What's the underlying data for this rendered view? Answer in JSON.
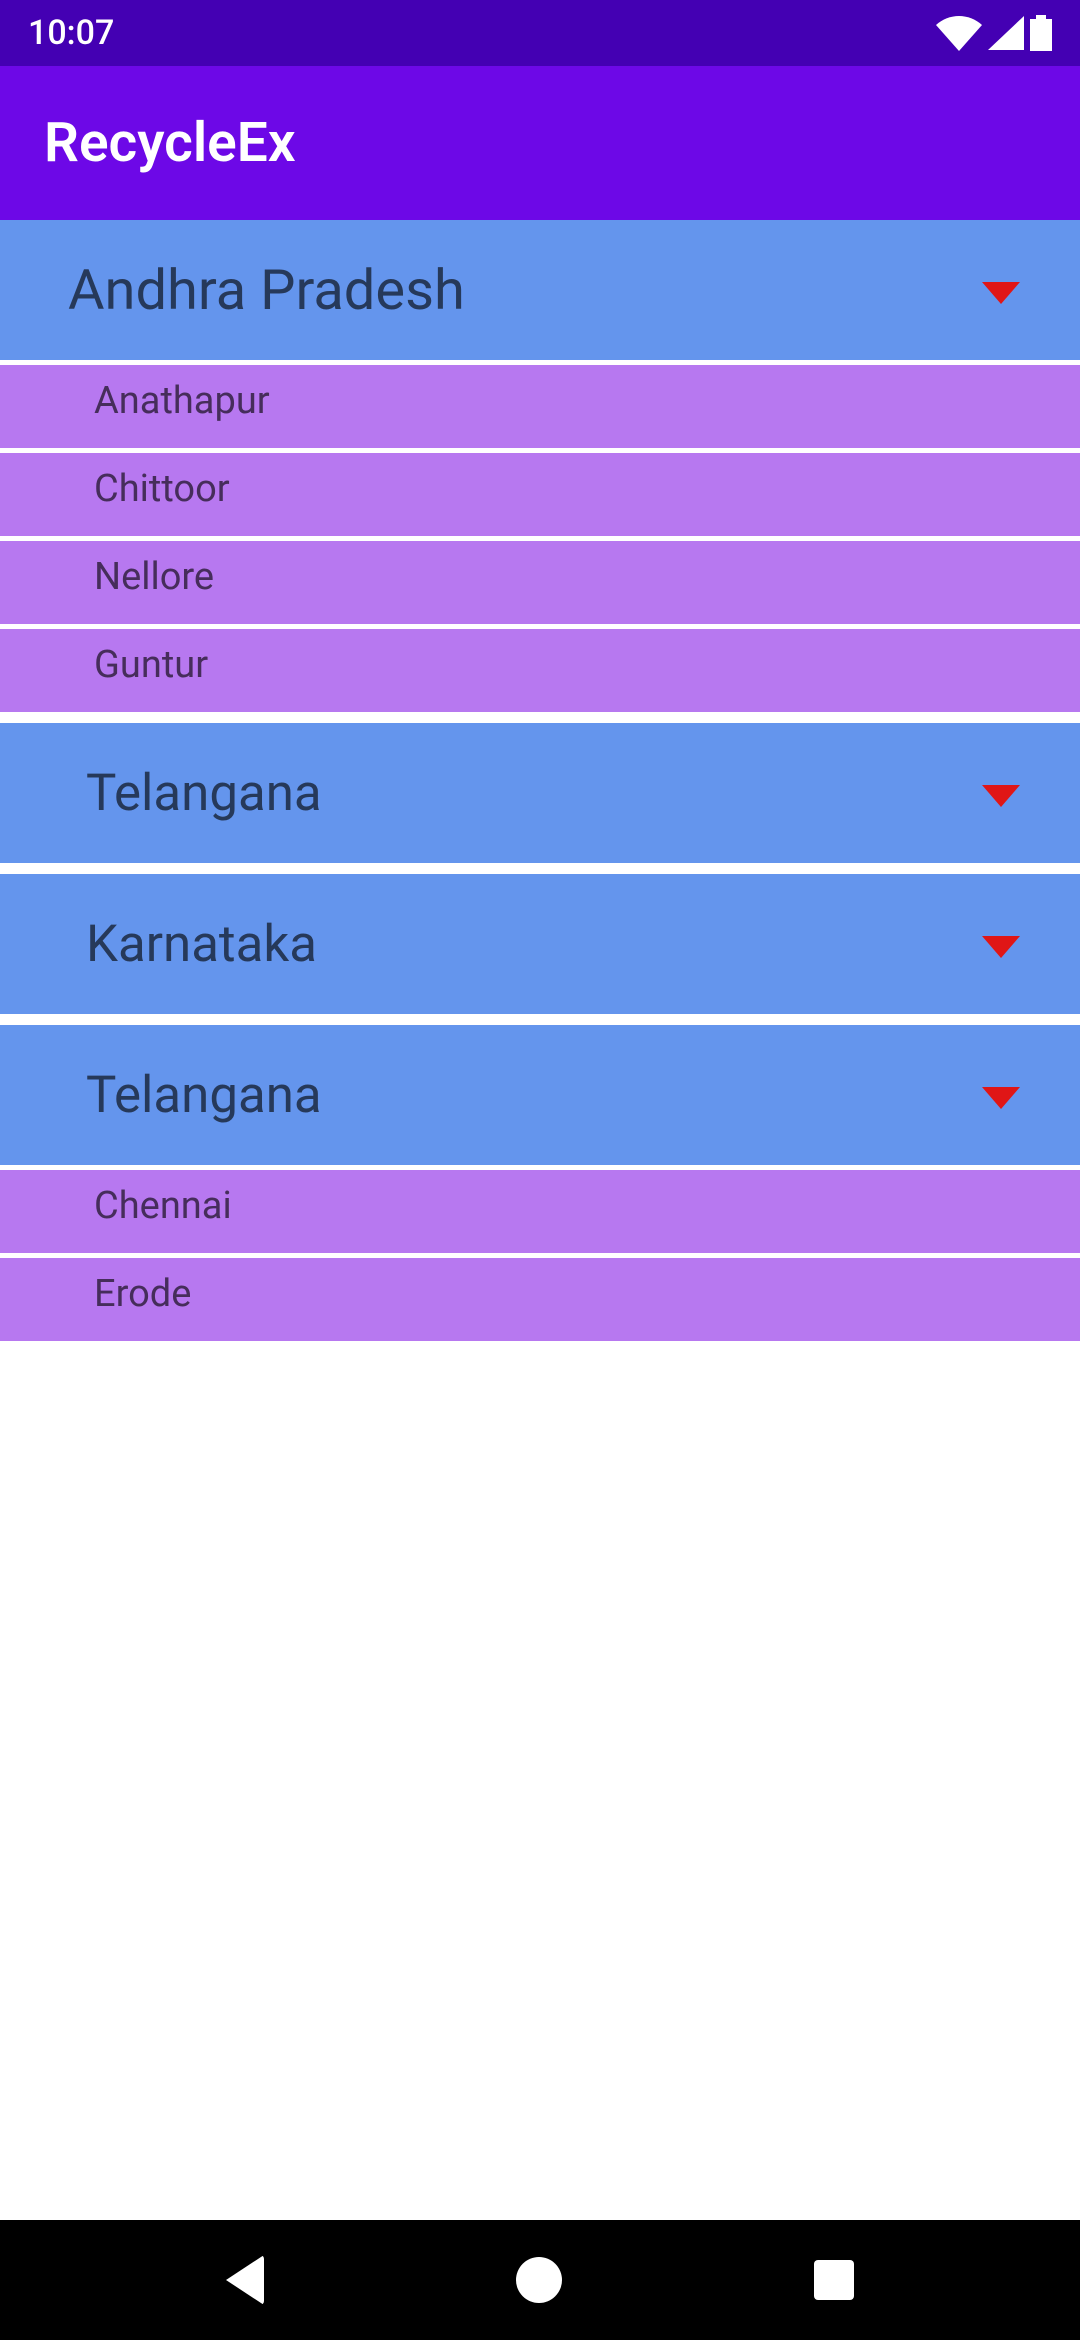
{
  "status": {
    "time": "10:07"
  },
  "app": {
    "title": "RecycleEx"
  },
  "groups": [
    {
      "name": "Andhra Pradesh",
      "expanded": true,
      "children": [
        "Anathapur",
        "Chittoor",
        "Nellore",
        "Guntur"
      ]
    },
    {
      "name": "Telangana",
      "expanded": false,
      "children": []
    },
    {
      "name": "Karnataka",
      "expanded": false,
      "children": []
    },
    {
      "name": "Telangana",
      "expanded": true,
      "children": [
        "Chennai",
        "Erode"
      ]
    }
  ],
  "colors": {
    "statusbar": "#4400b3",
    "appbar": "#6d08e7",
    "group_bg": "#6495ed",
    "child_bg": "#b778f0",
    "caret": "#e01616"
  }
}
